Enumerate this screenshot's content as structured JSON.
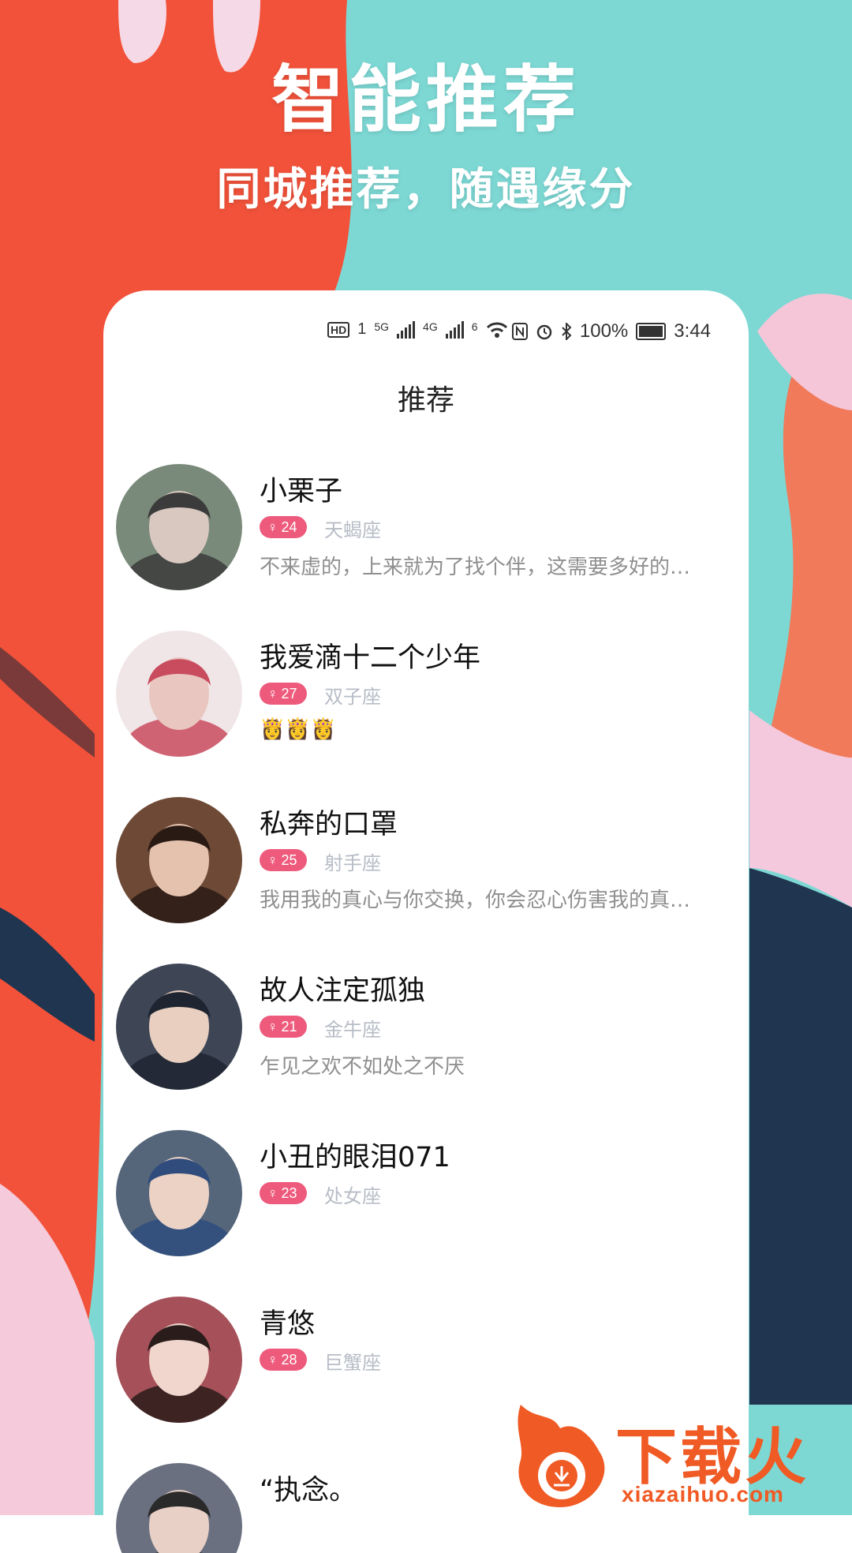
{
  "promo": {
    "title": "智能推荐",
    "subtitle": "同城推荐，随遇缘分"
  },
  "status_bar": {
    "hd": "HD",
    "sim1": "1",
    "net1": "5G",
    "net2": "4G",
    "wifi_gen": "6",
    "battery": "100%",
    "time": "3:44"
  },
  "header": {
    "title": "推荐"
  },
  "users": [
    {
      "name": "小栗子",
      "gender_symbol": "♀",
      "age": "24",
      "zodiac": "天蝎座",
      "bio": "不来虚的，上来就为了找个伴，这需要多好的…",
      "avatar_colors": [
        "#7a8a7a",
        "#d8c8c0",
        "#3b3b3b"
      ]
    },
    {
      "name": "我爱滴十二个少年",
      "gender_symbol": "♀",
      "age": "27",
      "zodiac": "双子座",
      "bio": "👸👸👸",
      "avatar_colors": [
        "#f0e6e8",
        "#e9c7c0",
        "#c94b5e"
      ]
    },
    {
      "name": "私奔的口罩",
      "gender_symbol": "♀",
      "age": "25",
      "zodiac": "射手座",
      "bio": "我用我的真心与你交换，你会忍心伤害我的真…",
      "avatar_colors": [
        "#6e4a36",
        "#e4c2ae",
        "#2a1a14"
      ]
    },
    {
      "name": "故人注定孤独",
      "gender_symbol": "♀",
      "age": "21",
      "zodiac": "金牛座",
      "bio": "乍见之欢不如处之不厌",
      "avatar_colors": [
        "#3e4656",
        "#e8cfc0",
        "#1e2430"
      ]
    },
    {
      "name": "小丑的眼泪071",
      "gender_symbol": "♀",
      "age": "23",
      "zodiac": "处女座",
      "bio": "",
      "avatar_colors": [
        "#55657a",
        "#ecd2c4",
        "#2f4c7c"
      ]
    },
    {
      "name": "青悠",
      "gender_symbol": "♀",
      "age": "28",
      "zodiac": "巨蟹座",
      "bio": "",
      "avatar_colors": [
        "#a6505a",
        "#f0d6cc",
        "#2a1c1a"
      ]
    },
    {
      "name": "“执念。",
      "gender_symbol": "",
      "age": "",
      "zodiac": "",
      "bio": "",
      "avatar_colors": [
        "#6a7080",
        "#e8d0c6",
        "#2a2a2a"
      ]
    }
  ],
  "watermark": {
    "brand": "下载火",
    "url": "xiazaihuo.com",
    "color": "#f05a24"
  }
}
